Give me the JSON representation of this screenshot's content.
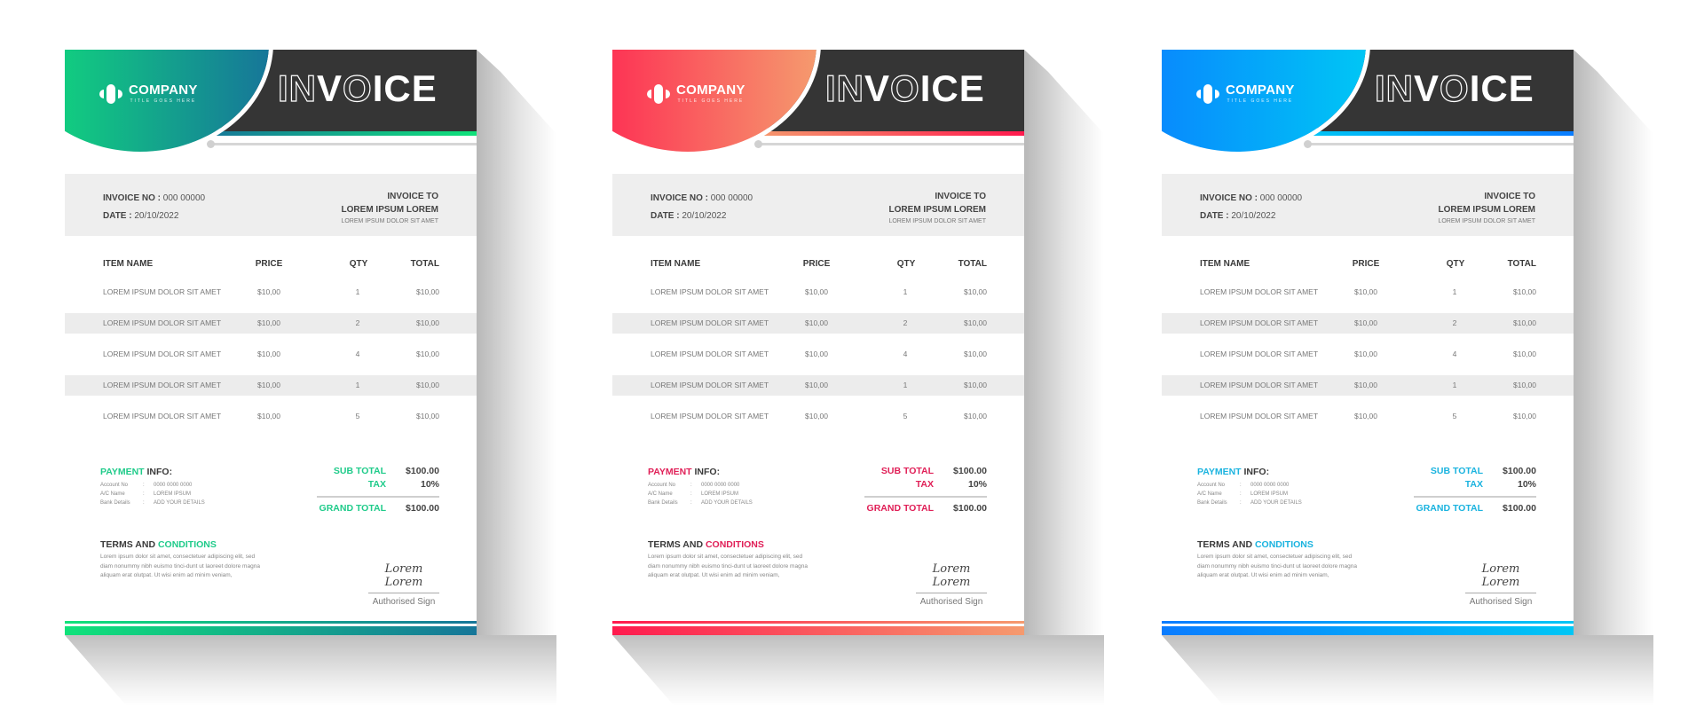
{
  "invoices": [
    {
      "theme": "green",
      "colors": {
        "start": "#10e27a",
        "end": "#167699",
        "accent": "#1fcb8a"
      },
      "company": {
        "name": "COMPANY",
        "tagline": "TITLE GOES HERE"
      },
      "title": {
        "outline": "IN",
        "solid_v": "V",
        "outline_o": "O",
        "solid_rest": "ICE"
      },
      "invoice_no_label": "INVOICE NO :",
      "invoice_no": "000 00000",
      "date_label": "DATE :",
      "date": "20/10/2022",
      "invoice_to_label": "INVOICE TO",
      "invoice_to_name": "LOREM IPSUM LOREM",
      "invoice_to_addr": "LOREM IPSUM DOLOR SIT AMET",
      "columns": [
        "ITEM NAME",
        "PRICE",
        "QTY",
        "TOTAL"
      ],
      "items": [
        {
          "name": "LOREM IPSUM DOLOR SIT AMET",
          "price": "$10,00",
          "qty": "1",
          "total": "$10,00"
        },
        {
          "name": "LOREM IPSUM DOLOR SIT AMET",
          "price": "$10,00",
          "qty": "2",
          "total": "$10,00"
        },
        {
          "name": "LOREM IPSUM DOLOR SIT AMET",
          "price": "$10,00",
          "qty": "4",
          "total": "$10,00"
        },
        {
          "name": "LOREM IPSUM DOLOR SIT AMET",
          "price": "$10,00",
          "qty": "1",
          "total": "$10,00"
        },
        {
          "name": "LOREM IPSUM DOLOR SIT AMET",
          "price": "$10,00",
          "qty": "5",
          "total": "$10,00"
        }
      ],
      "payment": {
        "title_colored": "PAYMENT",
        "title_rest": "INFO:",
        "lines": [
          {
            "k": "Account No",
            "v": "0000 0000 0000"
          },
          {
            "k": "A/C Name",
            "v": "LOREM IPSUM"
          },
          {
            "k": "Bank Details",
            "v": "ADD YOUR DETAILS"
          }
        ]
      },
      "totals": {
        "sub_total_label": "SUB TOTAL",
        "sub_total": "$100.00",
        "tax_label": "TAX",
        "tax": "10%",
        "grand_total_label": "GRAND TOTAL",
        "grand_total": "$100.00"
      },
      "terms": {
        "title_plain": "TERMS AND",
        "title_colored": "CONDITIONS",
        "text": "Lorem ipsum dolor sit amet, consectetuer adipiscing elit, sed diam nonummy nibh euismo tinci-dunt ut laoreet dolore magna aliquam erat olutpat. Ut wisi enim ad minim veniam,"
      },
      "signature": {
        "script": "Lorem Lorem",
        "label": "Authorised Sign"
      }
    },
    {
      "theme": "red",
      "colors": {
        "start": "#ff1a4e",
        "end": "#f59a6e",
        "accent": "#e01f57"
      },
      "company": {
        "name": "COMPANY",
        "tagline": "TITLE GOES HERE"
      },
      "title": {
        "outline": "IN",
        "solid_v": "V",
        "outline_o": "O",
        "solid_rest": "ICE"
      },
      "invoice_no_label": "INVOICE NO :",
      "invoice_no": "000 00000",
      "date_label": "DATE :",
      "date": "20/10/2022",
      "invoice_to_label": "INVOICE TO",
      "invoice_to_name": "LOREM IPSUM LOREM",
      "invoice_to_addr": "LOREM IPSUM DOLOR SIT AMET",
      "columns": [
        "ITEM NAME",
        "PRICE",
        "QTY",
        "TOTAL"
      ],
      "items": [
        {
          "name": "LOREM IPSUM DOLOR SIT AMET",
          "price": "$10,00",
          "qty": "1",
          "total": "$10,00"
        },
        {
          "name": "LOREM IPSUM DOLOR SIT AMET",
          "price": "$10,00",
          "qty": "2",
          "total": "$10,00"
        },
        {
          "name": "LOREM IPSUM DOLOR SIT AMET",
          "price": "$10,00",
          "qty": "4",
          "total": "$10,00"
        },
        {
          "name": "LOREM IPSUM DOLOR SIT AMET",
          "price": "$10,00",
          "qty": "1",
          "total": "$10,00"
        },
        {
          "name": "LOREM IPSUM DOLOR SIT AMET",
          "price": "$10,00",
          "qty": "5",
          "total": "$10,00"
        }
      ],
      "payment": {
        "title_colored": "PAYMENT",
        "title_rest": "INFO:",
        "lines": [
          {
            "k": "Account No",
            "v": "0000 0000 0000"
          },
          {
            "k": "A/C Name",
            "v": "LOREM IPSUM"
          },
          {
            "k": "Bank Details",
            "v": "ADD YOUR DETAILS"
          }
        ]
      },
      "totals": {
        "sub_total_label": "SUB TOTAL",
        "sub_total": "$100.00",
        "tax_label": "TAX",
        "tax": "10%",
        "grand_total_label": "GRAND TOTAL",
        "grand_total": "$100.00"
      },
      "terms": {
        "title_plain": "TERMS AND",
        "title_colored": "CONDITIONS",
        "text": "Lorem ipsum dolor sit amet, consectetuer adipiscing elit, sed diam nonummy nibh euismo tinci-dunt ut laoreet dolore magna aliquam erat olutpat. Ut wisi enim ad minim veniam,"
      },
      "signature": {
        "script": "Lorem Lorem",
        "label": "Authorised Sign"
      }
    },
    {
      "theme": "blue",
      "colors": {
        "start": "#0a7cff",
        "end": "#00c6f5",
        "accent": "#1ab3df"
      },
      "company": {
        "name": "COMPANY",
        "tagline": "TITLE GOES HERE"
      },
      "title": {
        "outline": "IN",
        "solid_v": "V",
        "outline_o": "O",
        "solid_rest": "ICE"
      },
      "invoice_no_label": "INVOICE NO :",
      "invoice_no": "000 00000",
      "date_label": "DATE :",
      "date": "20/10/2022",
      "invoice_to_label": "INVOICE TO",
      "invoice_to_name": "LOREM IPSUM LOREM",
      "invoice_to_addr": "LOREM IPSUM DOLOR SIT AMET",
      "columns": [
        "ITEM NAME",
        "PRICE",
        "QTY",
        "TOTAL"
      ],
      "items": [
        {
          "name": "LOREM IPSUM DOLOR SIT AMET",
          "price": "$10,00",
          "qty": "1",
          "total": "$10,00"
        },
        {
          "name": "LOREM IPSUM DOLOR SIT AMET",
          "price": "$10,00",
          "qty": "2",
          "total": "$10,00"
        },
        {
          "name": "LOREM IPSUM DOLOR SIT AMET",
          "price": "$10,00",
          "qty": "4",
          "total": "$10,00"
        },
        {
          "name": "LOREM IPSUM DOLOR SIT AMET",
          "price": "$10,00",
          "qty": "1",
          "total": "$10,00"
        },
        {
          "name": "LOREM IPSUM DOLOR SIT AMET",
          "price": "$10,00",
          "qty": "5",
          "total": "$10,00"
        }
      ],
      "payment": {
        "title_colored": "PAYMENT",
        "title_rest": "INFO:",
        "lines": [
          {
            "k": "Account No",
            "v": "0000 0000 0000"
          },
          {
            "k": "A/C Name",
            "v": "LOREM IPSUM"
          },
          {
            "k": "Bank Details",
            "v": "ADD YOUR DETAILS"
          }
        ]
      },
      "totals": {
        "sub_total_label": "SUB TOTAL",
        "sub_total": "$100.00",
        "tax_label": "TAX",
        "tax": "10%",
        "grand_total_label": "GRAND TOTAL",
        "grand_total": "$100.00"
      },
      "terms": {
        "title_plain": "TERMS AND",
        "title_colored": "CONDITIONS",
        "text": "Lorem ipsum dolor sit amet, consectetuer adipiscing elit, sed diam nonummy nibh euismo tinci-dunt ut laoreet dolore magna aliquam erat olutpat. Ut wisi enim ad minim veniam,"
      },
      "signature": {
        "script": "Lorem Lorem",
        "label": "Authorised Sign"
      }
    }
  ]
}
